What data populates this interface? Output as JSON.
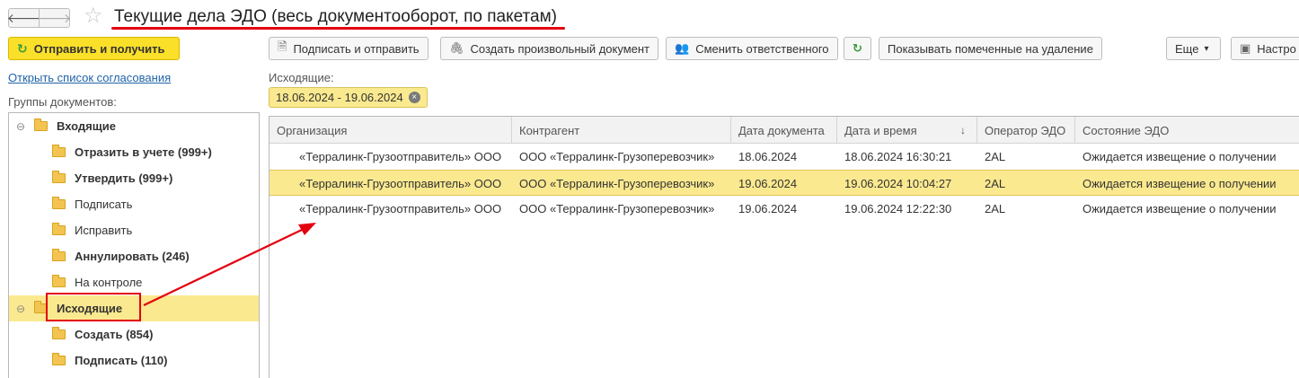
{
  "window": {
    "title": "Текущие дела ЭДО (весь документооборот, по пакетам)",
    "back_icon": "arrow-left-icon",
    "forward_icon": "arrow-right-icon",
    "favorite_icon": "star-icon"
  },
  "left": {
    "send_button": "Отправить и получить",
    "approval_link": "Открыть список согласования",
    "groups_label": "Группы документов:",
    "tree": [
      {
        "label": "Входящие",
        "bold": true,
        "level": 0,
        "toggle": "⊖"
      },
      {
        "label": "Отразить в учете (999+)",
        "bold": true,
        "level": 1
      },
      {
        "label": "Утвердить (999+)",
        "bold": true,
        "level": 1
      },
      {
        "label": "Подписать",
        "bold": false,
        "level": 1
      },
      {
        "label": "Исправить",
        "bold": false,
        "level": 1
      },
      {
        "label": "Аннулировать (246)",
        "bold": true,
        "level": 1
      },
      {
        "label": "На контроле",
        "bold": false,
        "level": 1
      },
      {
        "label": "Исходящие",
        "bold": true,
        "level": 0,
        "toggle": "⊖",
        "selected": true
      },
      {
        "label": "Создать (854)",
        "bold": true,
        "level": 1
      },
      {
        "label": "Подписать (110)",
        "bold": true,
        "level": 1
      }
    ]
  },
  "toolbar": {
    "sign_send": "Подписать и отправить",
    "create_doc": "Создать произвольный документ",
    "change_resp": "Сменить ответственного",
    "show_deleted": "Показывать помеченные на удаление",
    "more": "Еще",
    "more_arrow": "▾",
    "settings": "Настро"
  },
  "filter": {
    "label": "Исходящие:",
    "chip": "18.06.2024 - 19.06.2024",
    "chip_clear": "×"
  },
  "table": {
    "columns": [
      "Организация",
      "Контрагент",
      "Дата документа",
      "Дата и время",
      "Оператор ЭДО",
      "Состояние ЭДО"
    ],
    "sort_indicator": "↓",
    "rows": [
      [
        "«Терралинк-Грузоотправитель» ООО",
        "ООО «Терралинк-Грузоперевозчик»",
        "18.06.2024",
        "18.06.2024 16:30:21",
        "2AL",
        "Ожидается извещение о получении"
      ],
      [
        "«Терралинк-Грузоотправитель» ООО",
        "ООО «Терралинк-Грузоперевозчик»",
        "19.06.2024",
        "19.06.2024 10:04:27",
        "2AL",
        "Ожидается извещение о получении"
      ],
      [
        "«Терралинк-Грузоотправитель» ООО",
        "ООО «Терралинк-Грузоперевозчик»",
        "19.06.2024",
        "19.06.2024 12:22:30",
        "2AL",
        "Ожидается извещение о получении"
      ]
    ],
    "selected_row": 1
  },
  "colors": {
    "accent_yellow": "#fbe02a",
    "selection": "#fbe98f",
    "annotation_red": "#e3000f",
    "link": "#2064a8"
  }
}
